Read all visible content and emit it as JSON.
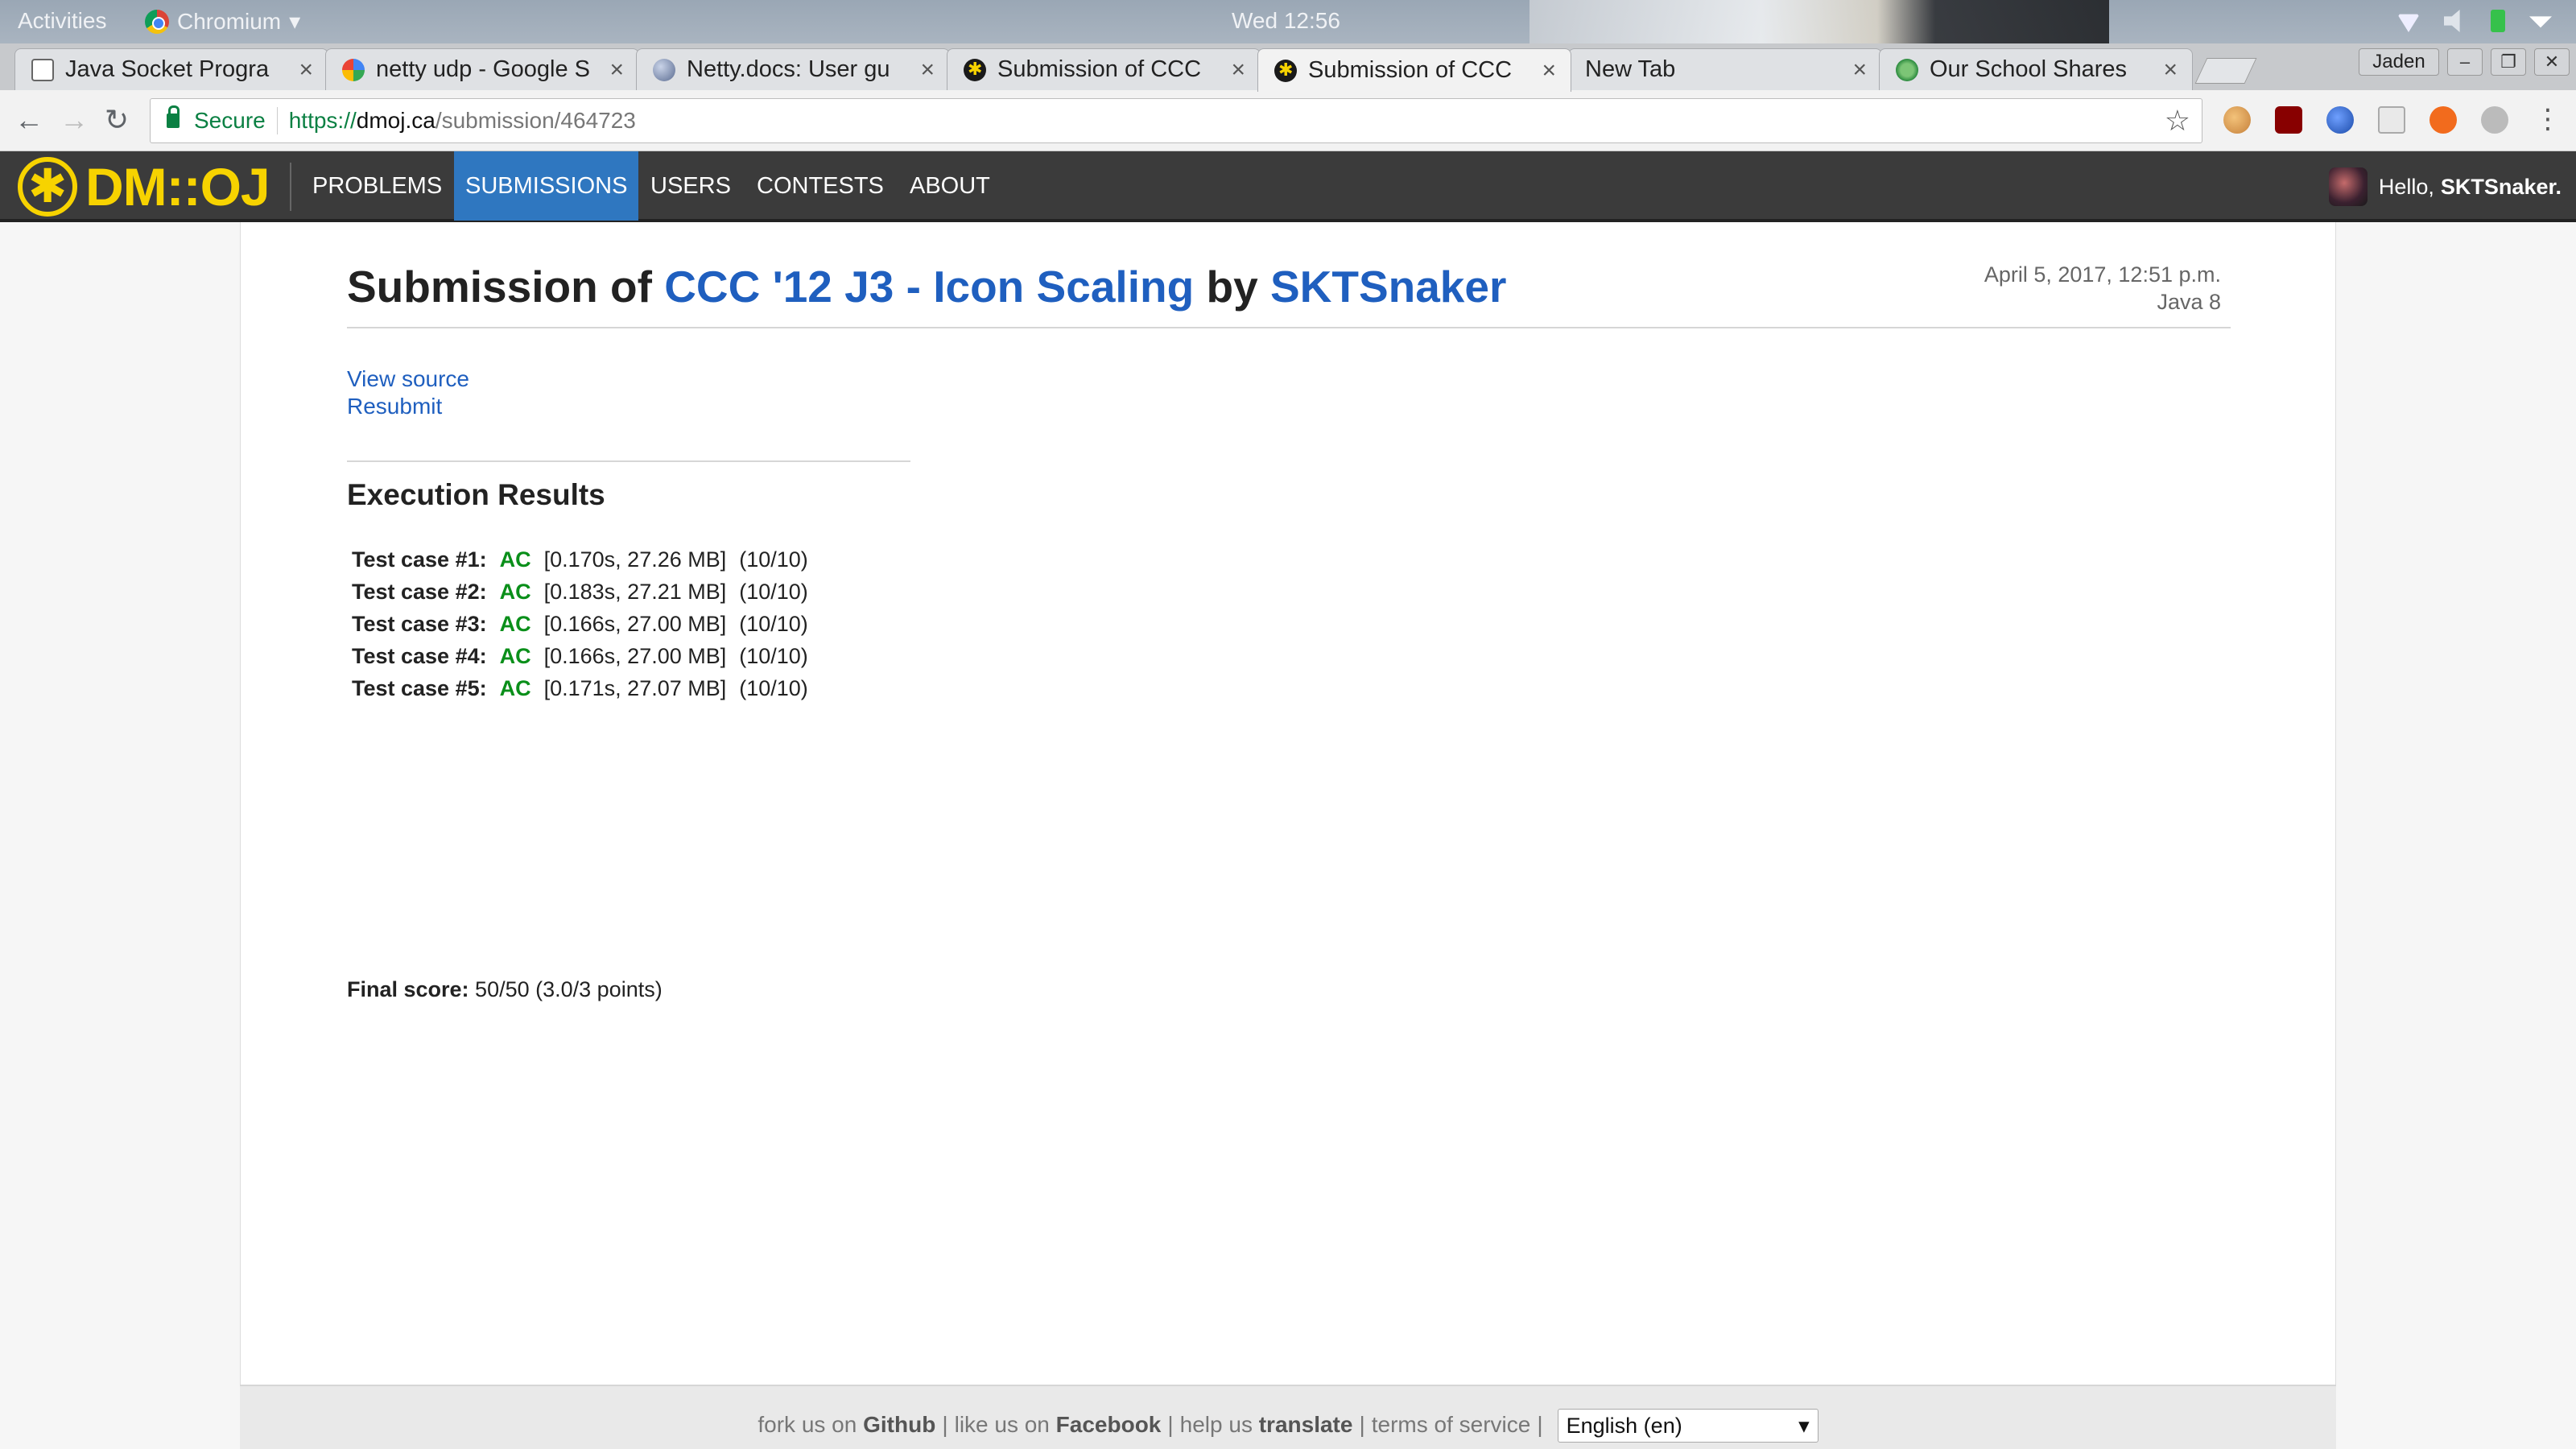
{
  "desktop": {
    "activities": "Activities",
    "app_name": "Chromium",
    "clock": "Wed 12:56"
  },
  "browser": {
    "tabs": [
      {
        "title": "Java Socket Progra",
        "favicon": "document-icon"
      },
      {
        "title": "netty udp - Google S",
        "favicon": "google-icon"
      },
      {
        "title": "Netty.docs: User gu",
        "favicon": "globe-icon"
      },
      {
        "title": "Submission of CCC",
        "favicon": "dmoj-icon"
      },
      {
        "title": "Submission of CCC",
        "favicon": "dmoj-icon"
      },
      {
        "title": "New Tab",
        "favicon": ""
      },
      {
        "title": "Our School Shares",
        "favicon": "shares-icon"
      }
    ],
    "active_tab_index": 4,
    "profile_name": "Jaden",
    "omnibox": {
      "secure_label": "Secure",
      "scheme": "https://",
      "host": "dmoj.ca",
      "path": "/submission/464723"
    }
  },
  "site": {
    "logo_text": "DM::OJ",
    "nav": [
      "PROBLEMS",
      "SUBMISSIONS",
      "USERS",
      "CONTESTS",
      "ABOUT"
    ],
    "active_nav": "SUBMISSIONS",
    "greeting": "Hello, ",
    "username": "SKTSnaker."
  },
  "submission": {
    "heading_prefix": "Submission of ",
    "problem": "CCC '12 J3 - Icon Scaling",
    "by": " by ",
    "author": "SKTSnaker",
    "date": "April 5, 2017, 12:51 p.m.",
    "language": "Java 8",
    "view_source": "View source",
    "resubmit": "Resubmit",
    "execution_title": "Execution Results",
    "test_cases": [
      {
        "label": "Test case #1:",
        "status": "AC",
        "stats": "[0.170s, 27.26 MB]",
        "score": "(10/10)"
      },
      {
        "label": "Test case #2:",
        "status": "AC",
        "stats": "[0.183s, 27.21 MB]",
        "score": "(10/10)"
      },
      {
        "label": "Test case #3:",
        "status": "AC",
        "stats": "[0.166s, 27.00 MB]",
        "score": "(10/10)"
      },
      {
        "label": "Test case #4:",
        "status": "AC",
        "stats": "[0.166s, 27.00 MB]",
        "score": "(10/10)"
      },
      {
        "label": "Test case #5:",
        "status": "AC",
        "stats": "[0.171s, 27.07 MB]",
        "score": "(10/10)"
      }
    ],
    "final_label": "Final score:",
    "final_value": " 50/50 (3.0/3 points)"
  },
  "footer": {
    "fork_prefix": "fork us on ",
    "fork_link": "Github",
    "like_prefix": "like us on ",
    "like_link": "Facebook",
    "help_prefix": "help us ",
    "help_link": "translate",
    "terms": "terms of service",
    "language": "English (en)"
  },
  "colors": {
    "accent": "#f7d300",
    "nav_active": "#2f77c0",
    "link": "#1f5fbf",
    "ac": "#0a8f1a"
  }
}
